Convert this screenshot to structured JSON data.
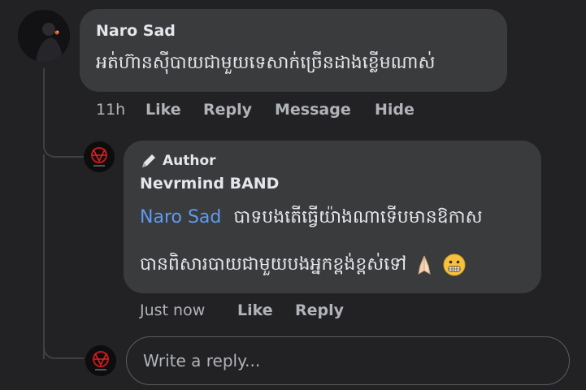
{
  "comment": {
    "author": "Naro Sad",
    "text": "អត់ហ៊ានស៊ីបាយជាមួយទេសាក់ច្រើនដាងខ្លើមណាស់",
    "time": "11h",
    "actions": {
      "like": "Like",
      "reply": "Reply",
      "message": "Message",
      "hide": "Hide"
    }
  },
  "reply": {
    "badge": "Author",
    "author": "Nevrmind BAND",
    "mention": "Naro Sad",
    "line1": "បាទបងតើធ្វើយ៉ាងណាទើបមានឱកាស",
    "line2": "បានពិសារបាយជាមួយបងអ្នកខ្ពង់ខ្ពស់ទៅ",
    "emojis": [
      "folded-hands",
      "grimacing-face"
    ],
    "time": "Just now",
    "actions": {
      "like": "Like",
      "reply": "Reply"
    }
  },
  "composer": {
    "placeholder": "Write a reply..."
  },
  "colors": {
    "background": "#222224",
    "bubble": "#3a3b3c",
    "mention": "#5d9bf0",
    "band_logo": "#c4161c"
  }
}
